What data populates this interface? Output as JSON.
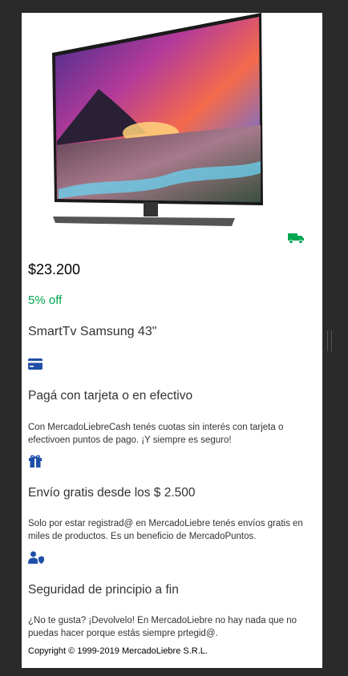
{
  "product": {
    "image_alt": "Samsung TV",
    "price": "$23.200",
    "discount": "5% off",
    "title": "SmartTv Samsung 43\""
  },
  "benefits": [
    {
      "icon": "credit-card-icon",
      "title": "Pagá con tarjeta o en efectivo",
      "description": "Con MercadoLiebreCash tenés cuotas sin interés con tarjeta o efectivoen puntos de pago. ¡Y siempre es seguro!"
    },
    {
      "icon": "gift-icon",
      "title": "Envío gratis desde los $ 2.500",
      "description": "Solo por estar registrad@ en MercadoLiebre tenés envíos gratis en miles de productos. Es un beneficio de MercadoPuntos."
    },
    {
      "icon": "user-shield-icon",
      "title": "Seguridad de principio a fin",
      "description": "¿No te gusta? ¡Devolvelo! En MercadoLiebre no hay nada que no puedas hacer porque estás siempre prtegid@."
    }
  ],
  "footer": {
    "copyright": "Copyright © 1999-2019 MercadoLiebre S.R.L."
  },
  "colors": {
    "accent_green": "#00a650",
    "icon_blue": "#3483fa"
  }
}
